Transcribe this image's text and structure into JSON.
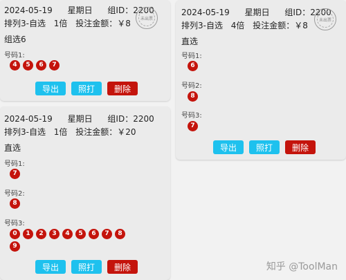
{
  "cards": [
    {
      "date": "2024-05-19",
      "weekday": "星期日",
      "group_id": "组ID：2200",
      "game": "排列3-自选",
      "multiplier": "1倍",
      "bet_amount": "投注金额：￥8",
      "mode": "组选6",
      "stamp": "未出票",
      "rows": [
        {
          "label": "号码1:",
          "balls": [
            "4",
            "5",
            "6",
            "7"
          ]
        }
      ],
      "buttons": {
        "export": "导出",
        "print": "照打",
        "delete": "删除"
      }
    },
    {
      "date": "2024-05-19",
      "weekday": "星期日",
      "group_id": "组ID：2200",
      "game": "排列3-自选",
      "multiplier": "1倍",
      "bet_amount": "投注金额：￥20",
      "mode": "直选",
      "stamp": "未出票",
      "rows": [
        {
          "label": "号码1:",
          "balls": [
            "7"
          ]
        },
        {
          "label": "号码2:",
          "balls": [
            "8"
          ]
        },
        {
          "label": "号码3:",
          "balls": [
            "0",
            "1",
            "2",
            "3",
            "4",
            "5",
            "6",
            "7",
            "8",
            "9"
          ]
        }
      ],
      "buttons": {
        "export": "导出",
        "print": "照打",
        "delete": "删除"
      }
    },
    {
      "date": "2024-05-19",
      "weekday": "星期日",
      "group_id": "组ID：2200",
      "game": "排列3-自选",
      "multiplier": "4倍",
      "bet_amount": "投注金额：￥8",
      "mode": "直选",
      "stamp": "未出票",
      "rows": [
        {
          "label": "号码1:",
          "balls": [
            "6"
          ]
        },
        {
          "label": "号码2:",
          "balls": [
            "8"
          ]
        },
        {
          "label": "号码3:",
          "balls": [
            "7"
          ]
        }
      ],
      "buttons": {
        "export": "导出",
        "print": "照打",
        "delete": "删除"
      }
    }
  ],
  "watermark": "知乎 @ToolMan"
}
